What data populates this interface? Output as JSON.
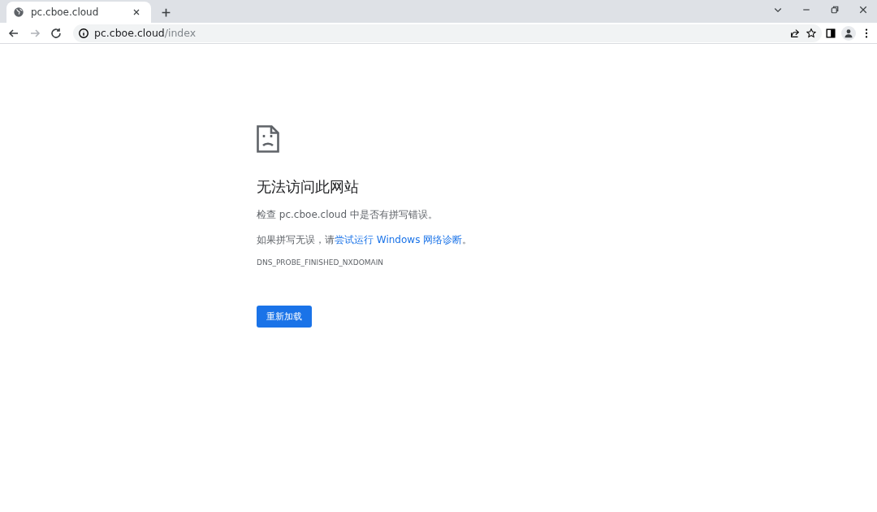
{
  "tabs": [
    {
      "title": "pc.cboe.cloud",
      "selected": true
    }
  ],
  "nav_buttons": [
    {
      "kind": "back",
      "disabled": false
    },
    {
      "kind": "forward",
      "disabled": true
    },
    {
      "kind": "reload",
      "disabled": false
    }
  ],
  "address_bar": {
    "host": "pc.cboe.cloud",
    "path": "/index"
  },
  "error_page": {
    "title": "无法访问此网站",
    "check_text": "检查 pc.cboe.cloud 中是否有拼写错误。",
    "suggestion_prefix": "如果拼写无误，请",
    "suggestion_link": "尝试运行 Windows 网络诊断",
    "suggestion_suffix": "。",
    "error_code": "DNS_PROBE_FINISHED_NXDOMAIN",
    "reload_button": "重新加载"
  }
}
